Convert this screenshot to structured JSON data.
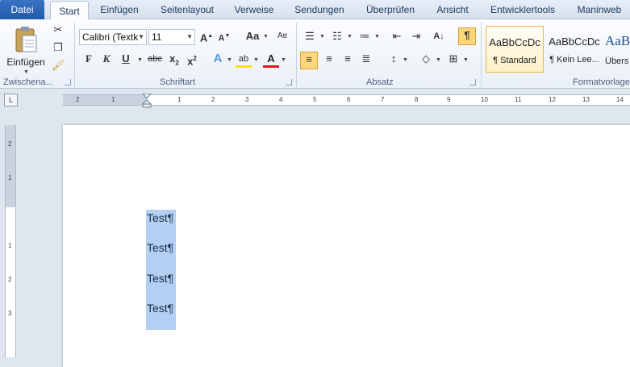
{
  "tabs": [
    "Datei",
    "Start",
    "Einfügen",
    "Seitenlayout",
    "Verweise",
    "Sendungen",
    "Überprüfen",
    "Ansicht",
    "Entwicklertools",
    "Maninweb"
  ],
  "clipboard": {
    "paste_label": "Einfügen",
    "group_label": "Zwischena..."
  },
  "font": {
    "name": "Calibri (Textk",
    "size": "11",
    "group_label": "Schriftart"
  },
  "paragraph": {
    "group_label": "Absatz"
  },
  "styles": {
    "group_label": "Formatvorlage",
    "items": [
      {
        "preview": "AaBbCcDc",
        "name": "¶ Standard"
      },
      {
        "preview": "AaBbCcDc",
        "name": "¶ Kein Lee..."
      },
      {
        "preview": "AaB",
        "name": "Übers"
      }
    ]
  },
  "ruler": {
    "h_ticks": [
      "2",
      "1",
      "1",
      "2",
      "3",
      "4",
      "5",
      "6",
      "7",
      "8",
      "9",
      "10",
      "11",
      "12",
      "13",
      "14"
    ],
    "v_ticks": [
      "2",
      "1",
      "1",
      "2",
      "3"
    ]
  },
  "document": {
    "lines": [
      "Test¶",
      "Test¶",
      "Test¶",
      "Test¶"
    ]
  }
}
